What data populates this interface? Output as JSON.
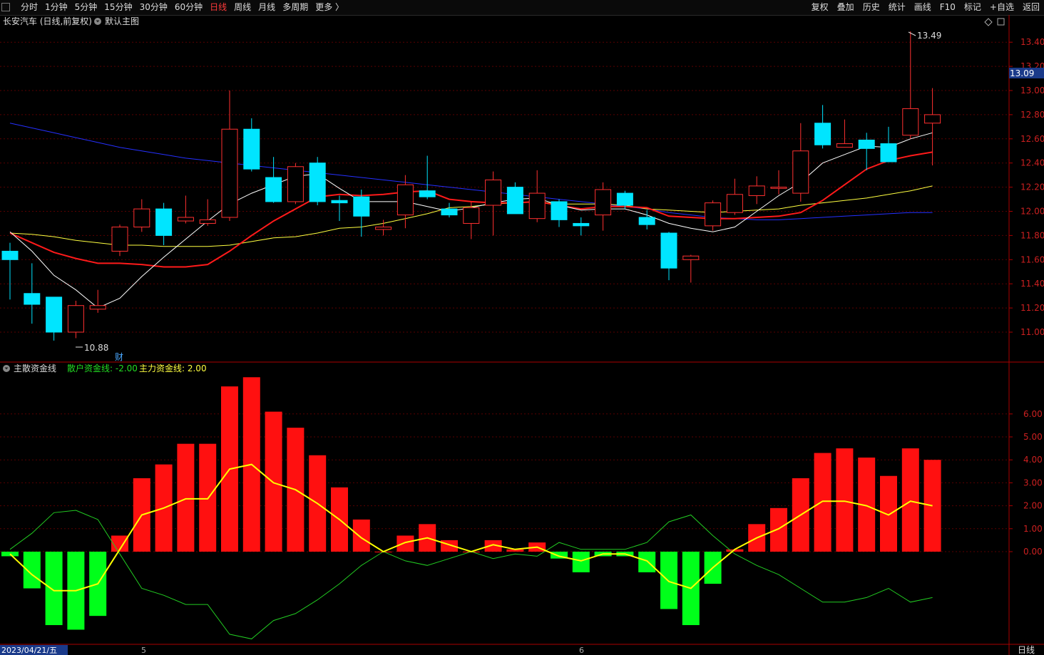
{
  "toolbar": {
    "periods": [
      "分时",
      "1分钟",
      "5分钟",
      "15分钟",
      "30分钟",
      "60分钟",
      "日线",
      "周线",
      "月线",
      "多周期",
      "更多 〉"
    ],
    "active_period": "日线",
    "right_tools": [
      "复权",
      "叠加",
      "历史",
      "统计",
      "画线",
      "F10",
      "标记",
      "+自选",
      "返回"
    ]
  },
  "main_chart": {
    "stock_title": "长安汽车 (日线,前复权)",
    "template_label": "默认主图",
    "ma5": [
      11.83,
      11.67,
      11.47,
      11.35,
      11.2,
      11.28,
      11.46,
      11.62,
      11.77,
      11.92,
      12.06,
      12.15,
      12.22,
      12.29,
      12.31,
      12.19,
      12.08,
      12.08,
      12.08,
      12.04,
      12.0,
      12.03,
      12.07,
      12.1,
      12.11,
      12.05,
      12.01,
      12.02,
      12.02,
      11.97,
      11.9,
      11.86,
      11.83,
      11.87,
      12.0,
      12.13,
      12.24,
      12.4,
      12.47,
      12.54,
      12.53,
      12.6,
      12.65
    ],
    "ma10": [
      11.82,
      11.74,
      11.66,
      11.61,
      11.57,
      11.57,
      11.56,
      11.54,
      11.54,
      11.56,
      11.67,
      11.8,
      11.92,
      12.02,
      12.12,
      12.14,
      12.13,
      12.14,
      12.16,
      12.17,
      12.1,
      12.08,
      12.07,
      12.07,
      12.08,
      12.05,
      12.02,
      12.04,
      12.04,
      12.03,
      11.96,
      11.95,
      11.94,
      11.94,
      11.95,
      11.96,
      11.99,
      12.09,
      12.22,
      12.35,
      12.42,
      12.46,
      12.49
    ],
    "ma20": [
      11.82,
      11.81,
      11.79,
      11.76,
      11.74,
      11.72,
      11.72,
      11.71,
      11.71,
      11.71,
      11.72,
      11.75,
      11.78,
      11.79,
      11.82,
      11.86,
      11.87,
      11.9,
      11.94,
      11.98,
      12.03,
      12.04,
      12.06,
      12.07,
      12.08,
      12.06,
      12.06,
      12.06,
      12.05,
      12.02,
      12.01,
      12.0,
      11.99,
      12.0,
      12.01,
      12.02,
      12.05,
      12.07,
      12.09,
      12.11,
      12.14,
      12.17,
      12.21
    ],
    "ma60": [
      12.73,
      12.69,
      12.65,
      12.61,
      12.57,
      12.53,
      12.5,
      12.47,
      12.44,
      12.42,
      12.4,
      12.38,
      12.36,
      12.34,
      12.32,
      12.3,
      12.28,
      12.26,
      12.24,
      12.22,
      12.2,
      12.18,
      12.16,
      12.14,
      12.12,
      12.1,
      12.08,
      12.06,
      12.04,
      12.02,
      11.99,
      11.97,
      11.95,
      11.94,
      11.93,
      11.93,
      11.94,
      11.95,
      11.96,
      11.97,
      11.98,
      11.99,
      11.99
    ],
    "high_label": "13.49",
    "low_label": "10.88",
    "price_tag": "13.09",
    "fin_marker": "财",
    "y_ticks": [
      "13.40",
      "13.20",
      "13.00",
      "12.80",
      "12.60",
      "12.40",
      "12.20",
      "12.00",
      "11.80",
      "11.60",
      "11.40",
      "11.20",
      "11.00"
    ],
    "candles": [
      [
        11.67,
        11.6,
        11.27,
        11.74
      ],
      [
        11.32,
        11.23,
        11.07,
        11.57
      ],
      [
        11.29,
        11.0,
        10.93,
        11.29
      ],
      [
        11.0,
        11.22,
        10.95,
        11.26
      ],
      [
        11.19,
        11.22,
        11.16,
        11.35
      ],
      [
        11.67,
        11.87,
        11.63,
        11.89
      ],
      [
        11.87,
        12.02,
        11.83,
        12.1
      ],
      [
        12.02,
        11.8,
        11.72,
        12.07
      ],
      [
        11.92,
        11.95,
        11.9,
        12.13
      ],
      [
        11.9,
        11.93,
        11.88,
        12.1
      ],
      [
        11.95,
        12.68,
        11.92,
        13.0
      ],
      [
        12.68,
        12.35,
        12.33,
        12.77
      ],
      [
        12.28,
        12.08,
        12.07,
        12.45
      ],
      [
        12.08,
        12.37,
        12.06,
        12.4
      ],
      [
        12.4,
        12.08,
        12.05,
        12.45
      ],
      [
        12.09,
        12.07,
        11.92,
        12.13
      ],
      [
        12.12,
        11.96,
        11.79,
        12.18
      ],
      [
        11.85,
        11.87,
        11.8,
        11.93
      ],
      [
        11.97,
        12.22,
        11.86,
        12.3
      ],
      [
        12.17,
        12.12,
        12.1,
        12.46
      ],
      [
        12.02,
        11.97,
        11.95,
        12.07
      ],
      [
        11.9,
        12.03,
        11.77,
        12.08
      ],
      [
        12.05,
        12.26,
        11.8,
        12.33
      ],
      [
        12.2,
        11.98,
        11.98,
        12.24
      ],
      [
        11.94,
        12.15,
        11.91,
        12.34
      ],
      [
        12.08,
        11.93,
        11.87,
        12.1
      ],
      [
        11.9,
        11.88,
        11.8,
        11.95
      ],
      [
        11.97,
        12.18,
        11.84,
        12.24
      ],
      [
        12.15,
        12.05,
        12.02,
        12.17
      ],
      [
        11.95,
        11.89,
        11.85,
        12.01
      ],
      [
        11.82,
        11.53,
        11.43,
        11.83
      ],
      [
        11.6,
        11.63,
        11.41,
        11.64
      ],
      [
        11.88,
        12.07,
        11.84,
        12.09
      ],
      [
        11.99,
        12.14,
        11.97,
        12.27
      ],
      [
        12.13,
        12.21,
        12.06,
        12.29
      ],
      [
        12.19,
        12.2,
        12.14,
        12.34
      ],
      [
        12.15,
        12.5,
        12.08,
        12.73
      ],
      [
        12.73,
        12.55,
        12.52,
        12.88
      ],
      [
        12.53,
        12.56,
        12.53,
        12.76
      ],
      [
        12.59,
        12.52,
        12.34,
        12.65
      ],
      [
        12.56,
        12.41,
        12.41,
        12.7
      ],
      [
        12.63,
        12.85,
        12.6,
        13.49
      ],
      [
        12.73,
        12.8,
        12.38,
        13.02
      ]
    ]
  },
  "indicator": {
    "title": "主散资金线",
    "retail_label": "散户资金线: -2.00",
    "main_label": "主力资金线: 2.00",
    "y_ticks": [
      "6.00",
      "5.00",
      "4.00",
      "3.00",
      "2.00",
      "1.00",
      "0.00"
    ],
    "bars": [
      -0.2,
      -1.6,
      -3.2,
      -3.4,
      -2.8,
      0.7,
      3.2,
      3.8,
      4.7,
      4.7,
      7.2,
      7.6,
      6.1,
      5.4,
      4.2,
      2.8,
      1.4,
      0.0,
      0.7,
      1.2,
      0.5,
      0.0,
      0.5,
      0.1,
      0.4,
      -0.3,
      -0.9,
      -0.2,
      -0.2,
      -0.9,
      -2.5,
      -3.2,
      -1.4,
      0.1,
      1.2,
      1.9,
      3.2,
      4.3,
      4.5,
      4.1,
      3.3,
      4.5,
      4.0
    ],
    "main_line": [
      -0.1,
      -1.0,
      -1.7,
      -1.7,
      -1.4,
      0.1,
      1.6,
      1.9,
      2.3,
      2.3,
      3.6,
      3.8,
      3.0,
      2.7,
      2.1,
      1.4,
      0.6,
      0.0,
      0.4,
      0.6,
      0.3,
      0.0,
      0.3,
      0.1,
      0.2,
      -0.2,
      -0.4,
      -0.1,
      -0.1,
      -0.4,
      -1.3,
      -1.6,
      -0.7,
      0.1,
      0.6,
      1.0,
      1.6,
      2.2,
      2.2,
      2.0,
      1.6,
      2.2,
      2.0
    ],
    "retail_line": [
      0.1,
      0.8,
      1.7,
      1.8,
      1.4,
      -0.1,
      -1.6,
      -1.9,
      -2.3,
      -2.3,
      -3.6,
      -3.8,
      -3.0,
      -2.7,
      -2.1,
      -1.4,
      -0.6,
      0.0,
      -0.4,
      -0.6,
      -0.3,
      0.0,
      -0.3,
      -0.1,
      -0.2,
      0.4,
      0.1,
      0.1,
      0.1,
      0.4,
      1.3,
      1.6,
      0.7,
      -0.1,
      -0.6,
      -1.0,
      -1.6,
      -2.2,
      -2.2,
      -2.0,
      -1.6,
      -2.2,
      -2.0
    ],
    "bar_up_color": "#ff1010",
    "bar_down_color": "#00ff1a",
    "main_line_color": "#ffff00",
    "retail_line_color": "#22cc22"
  },
  "bottom_bar": {
    "date_label": "2023/04/21/五",
    "marker_5": "5",
    "marker_6": "6",
    "period_label": "日线"
  }
}
